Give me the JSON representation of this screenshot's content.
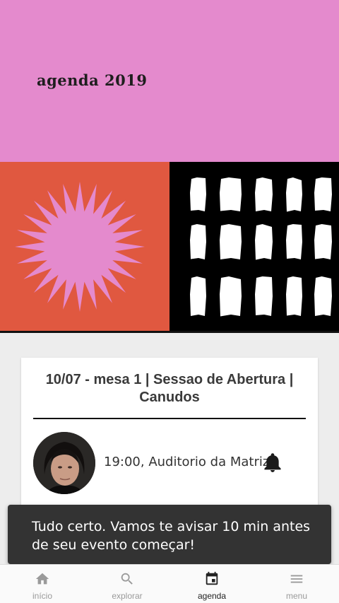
{
  "header": {
    "title": "agenda 2019"
  },
  "event_card": {
    "title": "10/07 - mesa 1 | Sessao de Abertura | Canudos",
    "time_location": "19:00, Auditorio da Matriz"
  },
  "snackbar": {
    "message": "Tudo certo. Vamos te avisar 10 min antes de seu evento começar!"
  },
  "bottom_nav": {
    "items": [
      {
        "label": "início",
        "icon": "home-icon"
      },
      {
        "label": "explorar",
        "icon": "search-icon"
      },
      {
        "label": "agenda",
        "icon": "calendar-icon"
      },
      {
        "label": "menu",
        "icon": "menu-icon"
      }
    ],
    "active": "agenda"
  },
  "colors": {
    "header_bg": "#e48acd",
    "art_orange": "#e05840",
    "art_pink": "#e48acd",
    "snackbar_bg": "#333333"
  }
}
